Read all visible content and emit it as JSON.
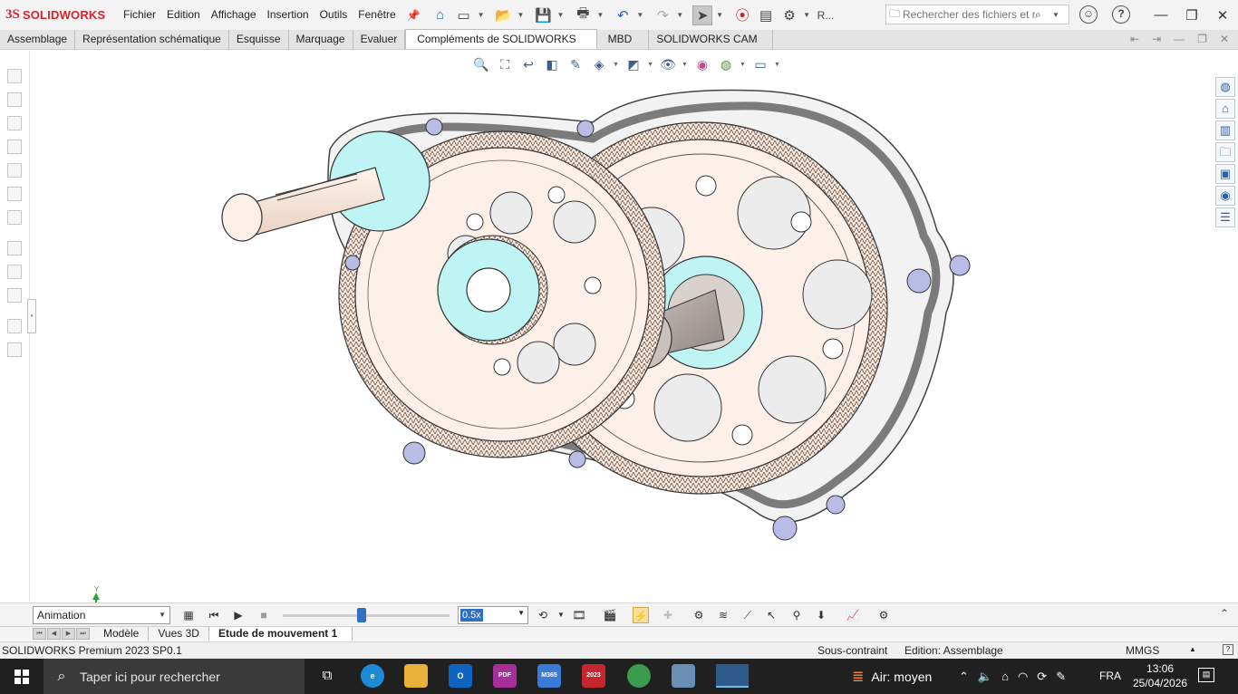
{
  "app": {
    "logo_prefix": "3S",
    "logo_text": "SOLIDWORKS",
    "menu": [
      "Fichier",
      "Edition",
      "Affichage",
      "Insertion",
      "Outils",
      "Fenêtre"
    ],
    "search_placeholder": "Rechercher des fichiers et m",
    "toolbar_truncated_label": "R..."
  },
  "command_tabs": [
    "Assemblage",
    "Représentation schématique",
    "Esquisse",
    "Marquage",
    "Evaluer",
    "Compléments de SOLIDWORKS",
    "MBD",
    "SOLIDWORKS CAM"
  ],
  "active_command_tab": "Compléments de SOLIDWORKS",
  "triad": {
    "y_label": "Y",
    "x_label": "X"
  },
  "motion_manager": {
    "study_type": "Animation",
    "speed": "0.5x",
    "playback_position": 0.47
  },
  "bottom_tabs": [
    "Modèle",
    "Vues 3D",
    "Etude de mouvement 1"
  ],
  "active_bottom_tab": "Etude de mouvement 1",
  "status": {
    "product": "SOLIDWORKS Premium 2023 SP0.1",
    "constraint": "Sous-contraint",
    "editing": "Edition: Assemblage",
    "units": "MMGS"
  },
  "taskbar": {
    "search_placeholder": "Taper ici pour rechercher",
    "apps": [
      {
        "name": "task-view",
        "label": "",
        "color": "#202020"
      },
      {
        "name": "edge",
        "label": "e",
        "color": "#1d8ad6"
      },
      {
        "name": "file-explorer",
        "label": "",
        "color": "#e8b23a"
      },
      {
        "name": "outlook",
        "label": "O",
        "color": "#0f64c2"
      },
      {
        "name": "pdf-app",
        "label": "PDF",
        "color": "#a72f9a"
      },
      {
        "name": "microsoft-365",
        "label": "M365",
        "color": "#3a7bd5"
      },
      {
        "name": "solidworks-2023",
        "label": "2023",
        "color": "#c8262e"
      },
      {
        "name": "chrome",
        "label": "",
        "color": "#3b9a4e"
      },
      {
        "name": "image-app",
        "label": "",
        "color": "#6a8fb5"
      },
      {
        "name": "solidworks-app",
        "label": "",
        "color": "#2f5b8c"
      }
    ],
    "weather": "Air: moyen",
    "language": "FRA",
    "time": "13:06",
    "date": "25/04/2026"
  }
}
